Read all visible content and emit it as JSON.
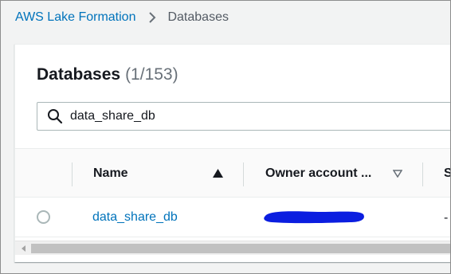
{
  "breadcrumb": {
    "root": "AWS Lake Formation",
    "current": "Databases"
  },
  "panel": {
    "title": "Databases",
    "count": "(1/153)"
  },
  "search": {
    "value": "data_share_db",
    "icon": "search-icon"
  },
  "table": {
    "columns": [
      {
        "label": "Name",
        "sort": "ascending"
      },
      {
        "label": "Owner account ...",
        "sort": "none"
      },
      {
        "label": "S"
      }
    ],
    "rows": [
      {
        "selected": false,
        "name": "data_share_db",
        "owner_account": "[redacted]",
        "col3": "-"
      }
    ]
  },
  "colors": {
    "link": "#0073bb",
    "redaction": "#0b1ee0",
    "text": "#16191f",
    "muted": "#687078"
  }
}
